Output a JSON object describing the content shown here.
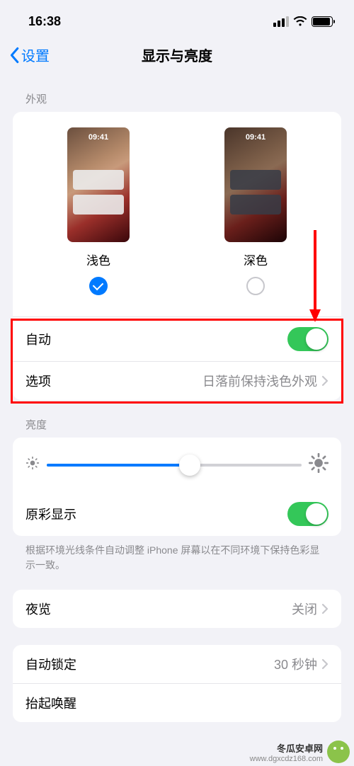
{
  "status": {
    "time": "16:38"
  },
  "nav": {
    "back": "设置",
    "title": "显示与亮度"
  },
  "sections": {
    "appearance": {
      "header": "外观",
      "light_label": "浅色",
      "dark_label": "深色",
      "preview_time": "09:41",
      "selected": "light",
      "auto_label": "自动",
      "auto_on": true,
      "options_label": "选项",
      "options_value": "日落前保持浅色外观"
    },
    "brightness": {
      "header": "亮度",
      "true_tone_label": "原彩显示",
      "true_tone_on": true,
      "footnote": "根据环境光线条件自动调整 iPhone 屏幕以在不同环境下保持色彩显示一致。",
      "slider_value": 0.56
    },
    "night_shift": {
      "label": "夜览",
      "value": "关闭"
    },
    "auto_lock": {
      "label": "自动锁定",
      "value": "30 秒钟"
    },
    "raise_to_wake": {
      "label": "抬起唤醒"
    }
  },
  "watermark": {
    "title": "冬瓜安卓网",
    "url": "www.dgxcdz168.com"
  }
}
